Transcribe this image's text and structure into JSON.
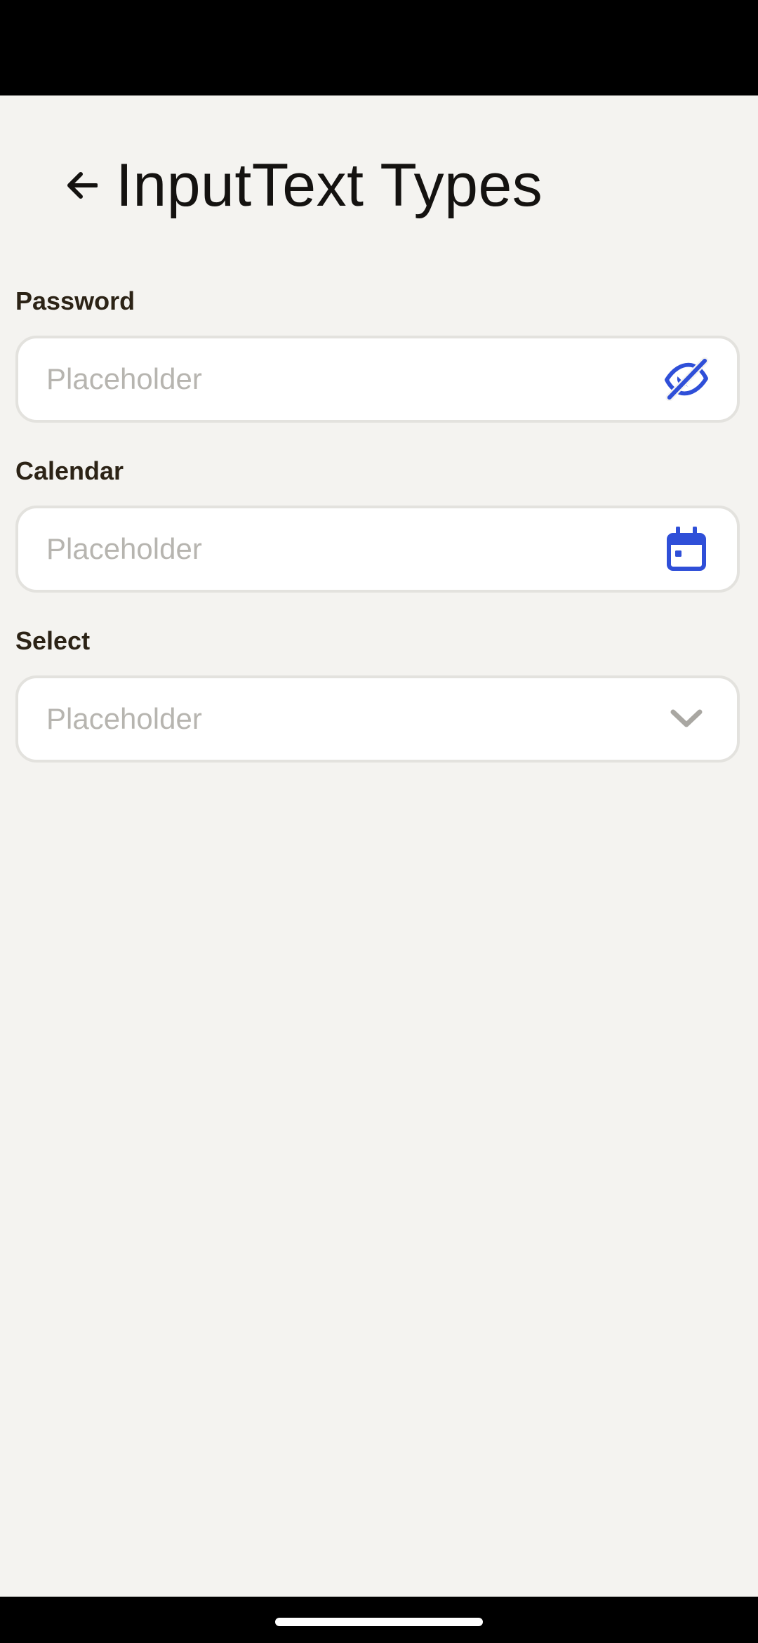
{
  "header": {
    "title": "InputText Types",
    "back_icon": "arrow-left-icon"
  },
  "fields": [
    {
      "label": "Password",
      "placeholder": "Placeholder",
      "icon": "eye-off-icon"
    },
    {
      "label": "Calendar",
      "placeholder": "Placeholder",
      "icon": "calendar-icon"
    },
    {
      "label": "Select",
      "placeholder": "Placeholder",
      "icon": "chevron-down-icon"
    }
  ],
  "colors": {
    "background": "#f4f3f0",
    "accent": "#2f4fd8",
    "label_text": "#2c2316",
    "placeholder_text": "#b7b5b0",
    "field_border": "#e3e2de",
    "chevron": "#a9a7a2"
  }
}
